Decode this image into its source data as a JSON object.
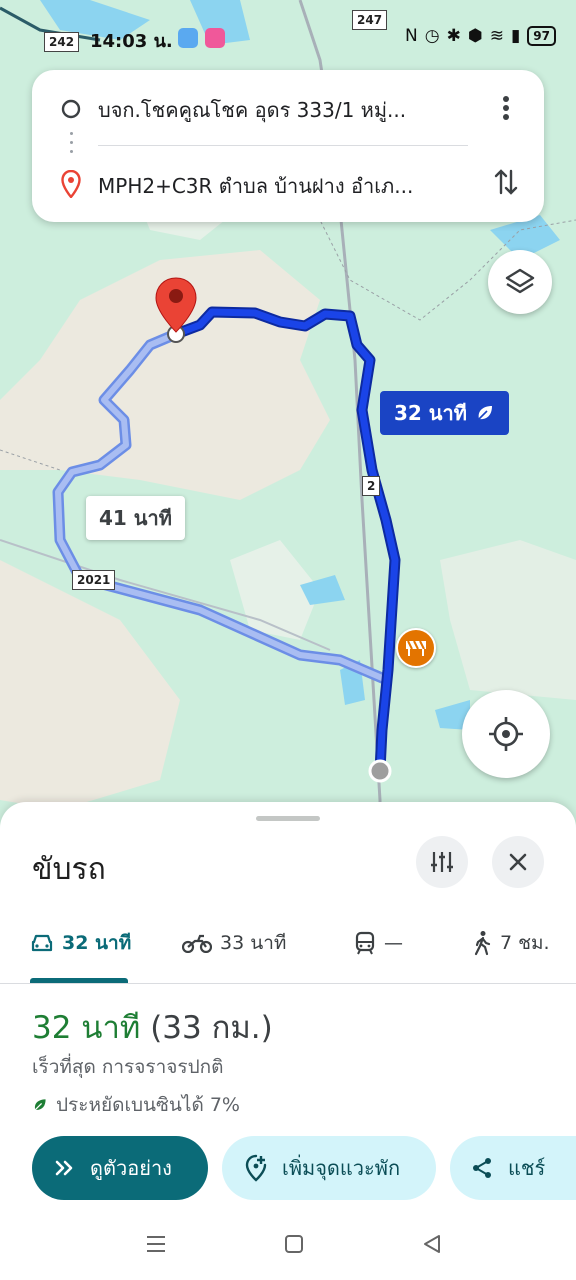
{
  "status_bar": {
    "time": "14:03 น.",
    "battery": "97"
  },
  "map": {
    "road_shields": [
      "242",
      "247",
      "2021",
      "2"
    ],
    "route_primary_time": "32 นาที",
    "route_alt_time": "41 นาที",
    "colors": {
      "primary_route": "#1a44c4",
      "alt_route": "#a9bdf2",
      "map_bg": "#cdeedd",
      "land": "#ece9df",
      "water": "#8cd4f0"
    }
  },
  "route_card": {
    "origin": "บจก.โชคคูณโชค อุดร 333/1 หมู่...",
    "destination": "MPH2+C3R ตำบล บ้านฝาง อำเภ...",
    "icons": {
      "origin": "origin-circle-icon",
      "destination": "destination-pin-icon",
      "menu": "more-vert-icon",
      "swap": "swap-vert-icon"
    }
  },
  "sheet": {
    "title": "ขับรถ",
    "modes": [
      {
        "icon": "car-icon",
        "label": "32 นาที"
      },
      {
        "icon": "motorcycle-icon",
        "label": "33 นาที"
      },
      {
        "icon": "train-icon",
        "label": "—"
      },
      {
        "icon": "walk-icon",
        "label": "7 ชม."
      }
    ],
    "summary": {
      "time": "32 นาที",
      "distance": "(33 กม.)",
      "subtitle": "เร็วที่สุด การจราจรปกติ",
      "eco": "ประหยัดเบนซินได้ 7%"
    },
    "actions": {
      "preview": "ดูตัวอย่าง",
      "add_stop": "เพิ่มจุดแวะพัก",
      "share": "แชร์"
    }
  }
}
